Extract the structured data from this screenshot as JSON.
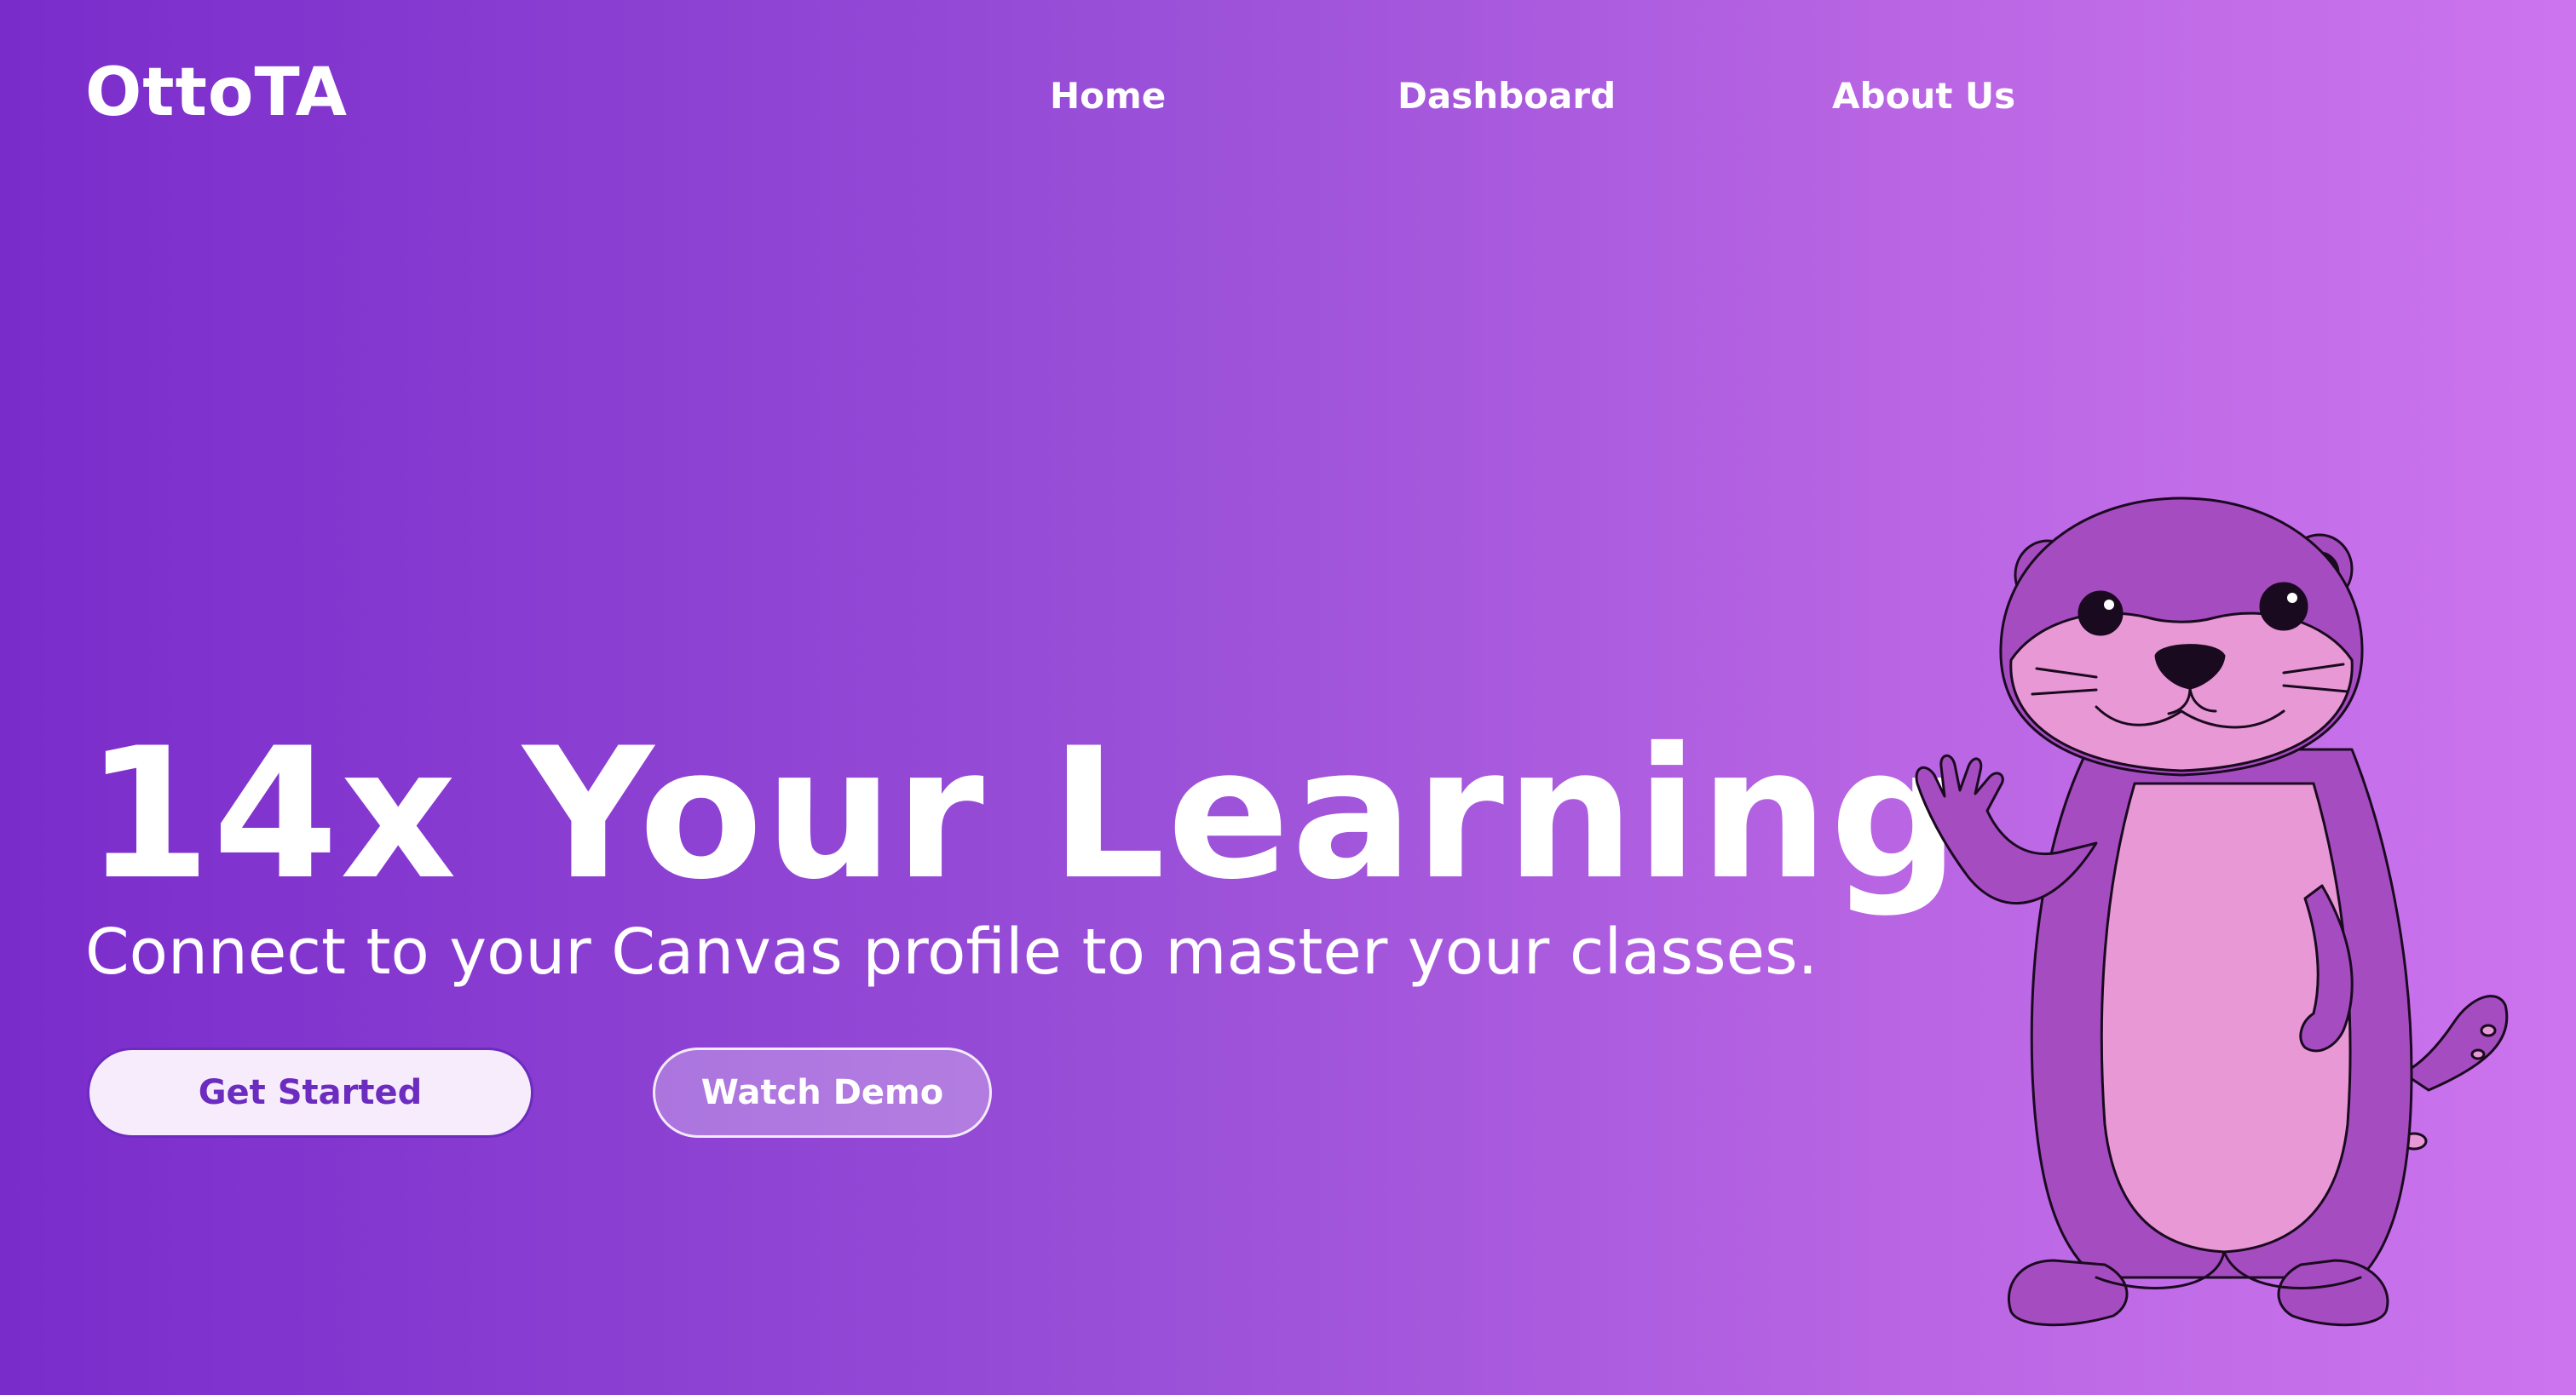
{
  "brand": {
    "name": "OttoTA"
  },
  "nav": {
    "items": [
      {
        "label": "Home"
      },
      {
        "label": "Dashboard"
      },
      {
        "label": "About Us"
      }
    ]
  },
  "hero": {
    "title": "14x Your Learning",
    "subtitle": "Connect to your Canvas profile to master your classes.",
    "primary_button": "Get Started",
    "secondary_button": "Watch Demo"
  },
  "mascot": {
    "icon": "otter-mascot-icon"
  },
  "colors": {
    "gradient_start": "#7a2ccb",
    "gradient_end": "#cc74ee",
    "button_primary_bg": "#f7ecfb",
    "button_primary_text": "#6b2cbf",
    "mascot_body": "#a64cc1",
    "mascot_belly": "#e898d4"
  }
}
